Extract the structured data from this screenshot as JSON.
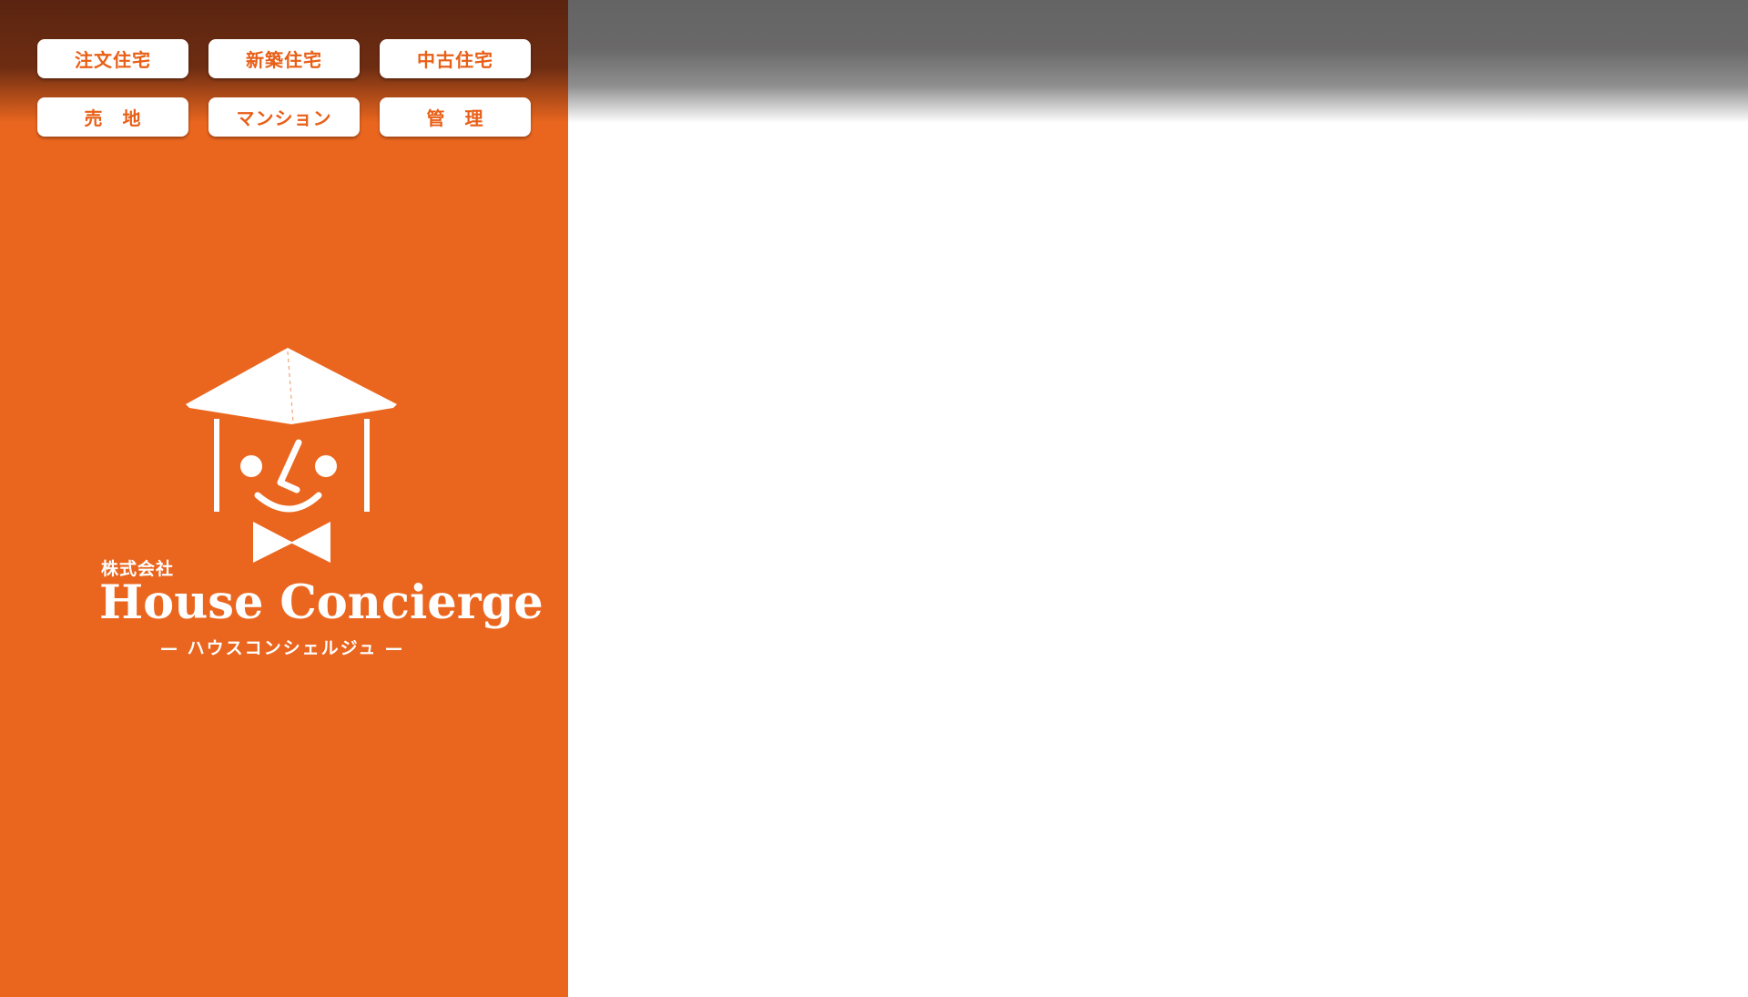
{
  "nav": {
    "items": [
      {
        "label": "注文住宅"
      },
      {
        "label": "新築住宅"
      },
      {
        "label": "中古住宅"
      },
      {
        "label": "売　地"
      },
      {
        "label": "マンション"
      },
      {
        "label": "管　理"
      }
    ]
  },
  "logo": {
    "company_kind": "株式会社",
    "company_name": "House Concierge",
    "company_kana": "— ハウスコンシェルジュ —",
    "mascot_icon": "graduate-house-mascot-icon"
  },
  "colors": {
    "brand_orange": "#ea661f",
    "nav_text": "#e85f17",
    "header_gray": "#656464",
    "white": "#ffffff"
  }
}
